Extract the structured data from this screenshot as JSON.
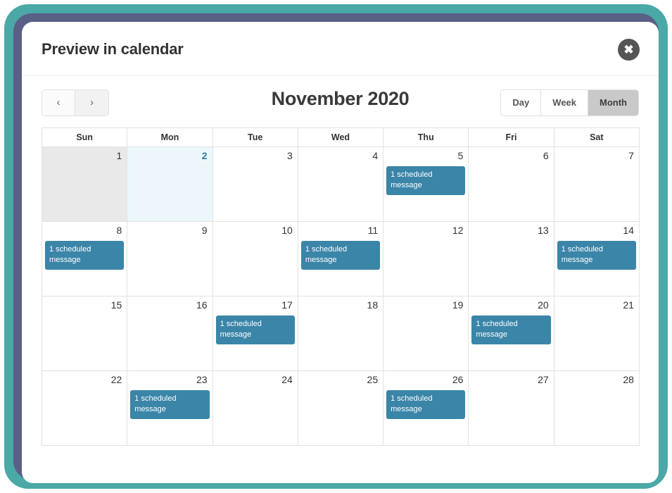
{
  "modal": {
    "title": "Preview in calendar",
    "close_icon": "close-x-icon",
    "close_label": "✖"
  },
  "toolbar": {
    "prev_label": "‹",
    "next_label": "›",
    "prev_icon": "chevron-left-icon",
    "next_icon": "chevron-right-icon",
    "current_period": "November 2020",
    "views": [
      {
        "label": "Day",
        "active": false
      },
      {
        "label": "Week",
        "active": false
      },
      {
        "label": "Month",
        "active": true
      }
    ]
  },
  "calendar": {
    "weekdays": [
      "Sun",
      "Mon",
      "Tue",
      "Wed",
      "Thu",
      "Fri",
      "Sat"
    ],
    "event_label": "1 scheduled message",
    "colors": {
      "event": "#3a85a8",
      "today_background": "#edf7fb",
      "today_number": "#2a7ba8",
      "past_background": "#e9e9e9",
      "grid_line": "#e2e2e2",
      "frame_outer": "#4aa8a6",
      "frame_inner": "#5a5f86"
    },
    "weeks": [
      [
        {
          "date": "1",
          "state": "past",
          "event": null
        },
        {
          "date": "2",
          "state": "today",
          "event": null
        },
        {
          "date": "3",
          "state": "normal",
          "event": null
        },
        {
          "date": "4",
          "state": "normal",
          "event": null
        },
        {
          "date": "5",
          "state": "normal",
          "event": "1 scheduled message"
        },
        {
          "date": "6",
          "state": "normal",
          "event": null
        },
        {
          "date": "7",
          "state": "normal",
          "event": null
        }
      ],
      [
        {
          "date": "8",
          "state": "normal",
          "event": "1 scheduled message"
        },
        {
          "date": "9",
          "state": "normal",
          "event": null
        },
        {
          "date": "10",
          "state": "normal",
          "event": null
        },
        {
          "date": "11",
          "state": "normal",
          "event": "1 scheduled message"
        },
        {
          "date": "12",
          "state": "normal",
          "event": null
        },
        {
          "date": "13",
          "state": "normal",
          "event": null
        },
        {
          "date": "14",
          "state": "normal",
          "event": "1 scheduled message"
        }
      ],
      [
        {
          "date": "15",
          "state": "normal",
          "event": null
        },
        {
          "date": "16",
          "state": "normal",
          "event": null
        },
        {
          "date": "17",
          "state": "normal",
          "event": "1 scheduled message"
        },
        {
          "date": "18",
          "state": "normal",
          "event": null
        },
        {
          "date": "19",
          "state": "normal",
          "event": null
        },
        {
          "date": "20",
          "state": "normal",
          "event": "1 scheduled message"
        },
        {
          "date": "21",
          "state": "normal",
          "event": null
        }
      ],
      [
        {
          "date": "22",
          "state": "normal",
          "event": null
        },
        {
          "date": "23",
          "state": "normal",
          "event": "1 scheduled message"
        },
        {
          "date": "24",
          "state": "normal",
          "event": null
        },
        {
          "date": "25",
          "state": "normal",
          "event": null
        },
        {
          "date": "26",
          "state": "normal",
          "event": "1 scheduled message"
        },
        {
          "date": "27",
          "state": "normal",
          "event": null
        },
        {
          "date": "28",
          "state": "normal",
          "event": null
        }
      ]
    ]
  }
}
